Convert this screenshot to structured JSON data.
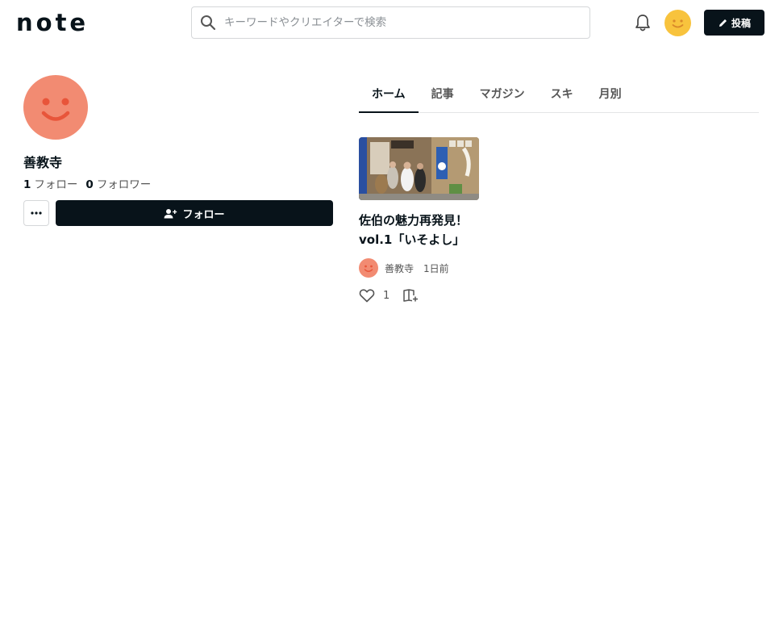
{
  "header": {
    "logo_text": "note",
    "search": {
      "placeholder": "キーワードやクリエイターで検索",
      "value": ""
    },
    "post_button_label": "投稿"
  },
  "profile": {
    "name": "善教寺",
    "following_count": "1",
    "following_label": "フォロー",
    "followers_count": "0",
    "followers_label": "フォロワー",
    "follow_button_label": "フォロー"
  },
  "tabs": [
    {
      "label": "ホーム",
      "active": true
    },
    {
      "label": "記事",
      "active": false
    },
    {
      "label": "マガジン",
      "active": false
    },
    {
      "label": "スキ",
      "active": false
    },
    {
      "label": "月別",
      "active": false
    }
  ],
  "articles": [
    {
      "title": "佐伯の魅力再発見！vol.1「いそよし」",
      "author": "善教寺",
      "time_ago": "1日前",
      "like_count": "1"
    }
  ],
  "colors": {
    "primary": "#08131a",
    "avatar_coral": "#f28b72",
    "avatar_face": "#e8553a",
    "user_avatar_yellow": "#f8c33d"
  },
  "icons": [
    "search-icon",
    "bell-icon",
    "pencil-icon",
    "more-icon",
    "person-add-icon",
    "heart-icon",
    "magazine-add-icon"
  ]
}
